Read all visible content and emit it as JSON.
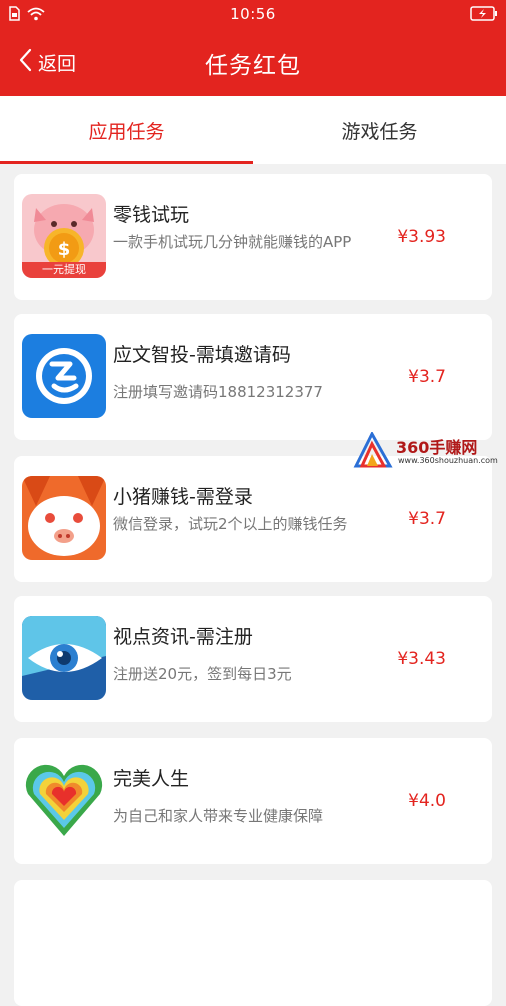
{
  "status_bar": {
    "time": "10:56",
    "icons": [
      "sim-icon",
      "wifi-icon",
      "battery-charging-icon"
    ]
  },
  "header": {
    "back_label": "返回",
    "title": "任务红包"
  },
  "tabs": [
    {
      "label": "应用任务",
      "active": true
    },
    {
      "label": "游戏任务",
      "active": false
    }
  ],
  "tasks": [
    {
      "name": "零钱试玩",
      "desc": "一款手机试玩几分钟就能赚钱的APP",
      "price": "¥3.93",
      "icon_text": "一元提现"
    },
    {
      "name": "应文智投-需填邀请码",
      "desc": "注册填写邀请码18812312377",
      "price": "¥3.7"
    },
    {
      "name": "小猪赚钱-需登录",
      "desc": "微信登录，试玩2个以上的赚钱任务",
      "price": "¥3.7"
    },
    {
      "name": "视点资讯-需注册",
      "desc": "注册送20元，签到每日3元",
      "price": "¥3.43"
    },
    {
      "name": "完美人生",
      "desc": "为自己和家人带来专业健康保障",
      "price": "¥4.0"
    }
  ],
  "watermark": {
    "title": "360手赚网",
    "url": "www.360shouzhuan.com"
  },
  "colors": {
    "brand_red": "#e3241f",
    "price_red": "#e3241f",
    "background": "#f1f1f1"
  }
}
